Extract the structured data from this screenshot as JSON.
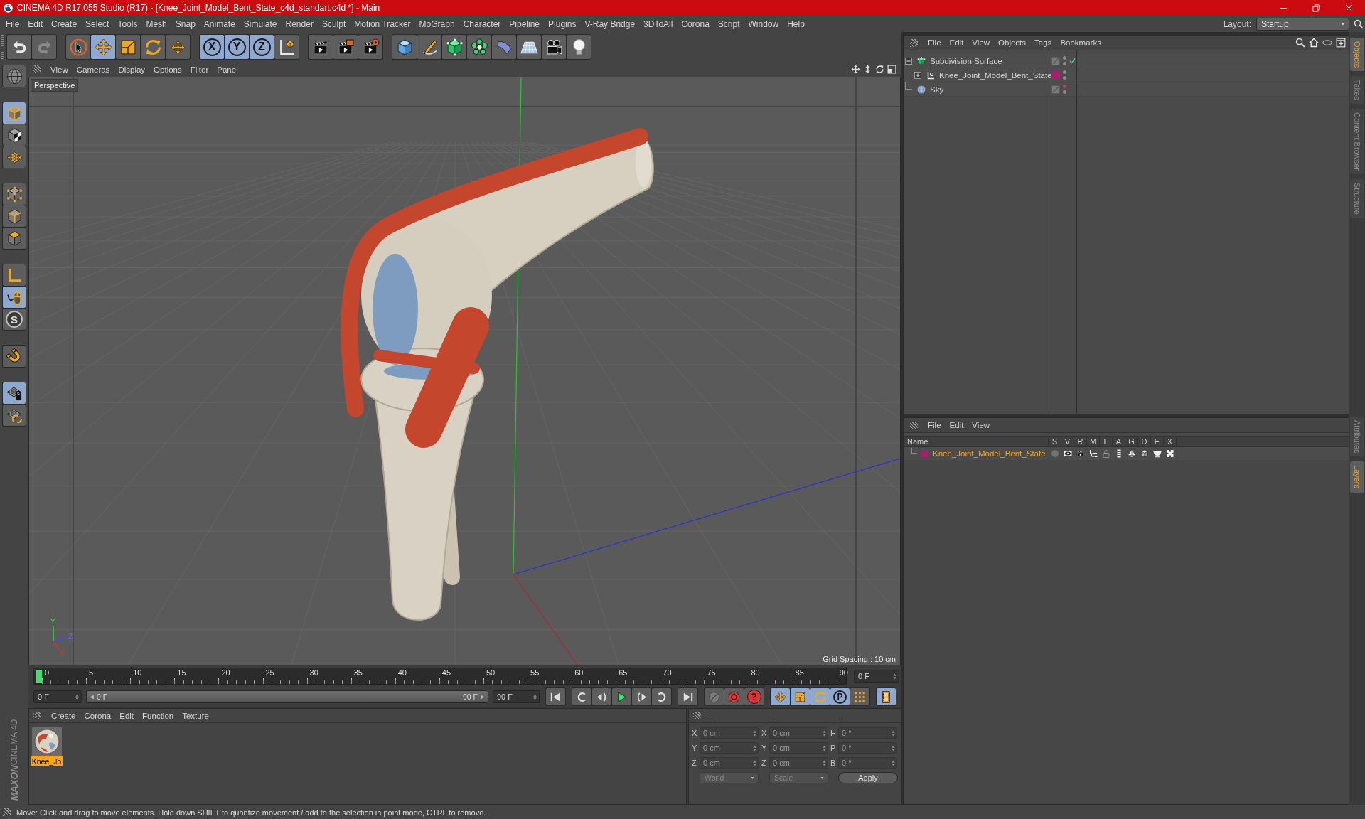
{
  "title_bar": {
    "title": "CINEMA 4D R17.055 Studio (R17) - [Knee_Joint_Model_Bent_State_c4d_standart.c4d *] - Main"
  },
  "menu_bar": {
    "items": [
      "File",
      "Edit",
      "Create",
      "Select",
      "Tools",
      "Mesh",
      "Snap",
      "Animate",
      "Simulate",
      "Render",
      "Sculpt",
      "Motion Tracker",
      "MoGraph",
      "Character",
      "Pipeline",
      "Plugins",
      "V-Ray Bridge",
      "3DToAll",
      "Corona",
      "Script",
      "Window",
      "Help"
    ],
    "layout_label": "Layout:",
    "layout_value": "Startup"
  },
  "toolbar": {
    "groups": [
      [
        {
          "kind": "undo",
          "active": false,
          "disabled": false
        },
        {
          "kind": "redo",
          "active": false,
          "disabled": true
        }
      ],
      [
        {
          "kind": "select",
          "active": false
        },
        {
          "kind": "move",
          "active": true
        },
        {
          "kind": "scale",
          "active": false
        },
        {
          "kind": "rotate",
          "active": false
        },
        {
          "kind": "transform",
          "active": false
        }
      ],
      [
        {
          "kind": "axis-lock",
          "label": "X",
          "active": true
        },
        {
          "kind": "axis-lock",
          "label": "Y",
          "active": true
        },
        {
          "kind": "axis-lock",
          "label": "Z",
          "active": true
        },
        {
          "kind": "coordinates",
          "active": false
        }
      ],
      [
        {
          "kind": "render-view",
          "active": false
        },
        {
          "kind": "render-picture",
          "active": false
        },
        {
          "kind": "render-settings",
          "active": false
        }
      ],
      [
        {
          "kind": "cube",
          "active": false
        },
        {
          "kind": "pen",
          "active": false
        },
        {
          "kind": "subdivision",
          "active": false
        },
        {
          "kind": "cloner",
          "active": false
        },
        {
          "kind": "bend",
          "active": false
        },
        {
          "kind": "floor",
          "active": false
        },
        {
          "kind": "camera",
          "active": false
        },
        {
          "kind": "light",
          "active": false
        }
      ]
    ]
  },
  "left_toolbar": {
    "groups": [
      [
        {
          "kind": "globe",
          "active": false
        }
      ],
      [
        {
          "kind": "model",
          "active": true
        },
        {
          "kind": "texture",
          "active": false
        },
        {
          "kind": "workplane",
          "active": false
        }
      ],
      [
        {
          "kind": "points-mode",
          "active": false
        },
        {
          "kind": "edges-mode",
          "active": false
        },
        {
          "kind": "polygons-mode",
          "active": false
        }
      ],
      [
        {
          "kind": "axis-mode",
          "active": false
        },
        {
          "kind": "tweak",
          "active": true
        },
        {
          "kind": "snap",
          "label": "S",
          "active": false
        }
      ],
      [
        {
          "kind": "magnet",
          "active": false
        }
      ],
      [
        {
          "kind": "workplane-lock",
          "active": true
        },
        {
          "kind": "grid-rotate",
          "active": false
        }
      ]
    ]
  },
  "logo": {
    "brand": "MAXON",
    "product": "CINEMA 4D"
  },
  "viewport": {
    "menu": [
      "View",
      "Cameras",
      "Display",
      "Options",
      "Filter",
      "Panel"
    ],
    "camera": "Perspective",
    "grid_spacing": "Grid Spacing : 10 cm",
    "axis_labels": {
      "y": "Y",
      "z": "Z",
      "x": "X"
    }
  },
  "timeline": {
    "ticks": [
      "0",
      "5",
      "10",
      "15",
      "20",
      "25",
      "30",
      "35",
      "40",
      "45",
      "50",
      "55",
      "60",
      "65",
      "70",
      "75",
      "80",
      "85",
      "90"
    ],
    "level": 0,
    "current_frame": "0 F"
  },
  "playback": {
    "start": "0 F",
    "range": {
      "start_label": "0 F",
      "end_label": "90 F",
      "level": 1
    },
    "end": "90 F",
    "transport": [
      {
        "kind": "go-start"
      },
      {
        "kind": "prev-key"
      },
      {
        "kind": "prev-frame"
      },
      {
        "kind": "play"
      },
      {
        "kind": "next-frame"
      },
      {
        "kind": "next-key"
      },
      {
        "kind": "go-end"
      }
    ],
    "key_buttons": [
      {
        "kind": "record"
      },
      {
        "kind": "autokey"
      },
      {
        "kind": "key-selection",
        "label": "?"
      }
    ],
    "modes": [
      {
        "kind": "move",
        "active": true
      },
      {
        "kind": "scale",
        "active": true
      },
      {
        "kind": "rotate",
        "active": true
      },
      {
        "kind": "param",
        "label": "P",
        "active": true
      },
      {
        "kind": "point-level",
        "active": false
      }
    ],
    "timeline_button": {
      "active": true
    }
  },
  "material_manager": {
    "menu": [
      "Create",
      "Corona",
      "Edit",
      "Function",
      "Texture"
    ],
    "materials": [
      {
        "name": "Knee_Jo",
        "selected": true
      }
    ]
  },
  "coordinates": {
    "columns": [
      {
        "header": "--",
        "fields": [
          {
            "label": "X",
            "value": "0 cm"
          },
          {
            "label": "Y",
            "value": "0 cm"
          },
          {
            "label": "Z",
            "value": "0 cm"
          }
        ]
      },
      {
        "header": "--",
        "fields": [
          {
            "label": "X",
            "value": "0 cm"
          },
          {
            "label": "Y",
            "value": "0 cm"
          },
          {
            "label": "Z",
            "value": "0 cm"
          }
        ]
      },
      {
        "header": "--",
        "fields": [
          {
            "label": "H",
            "value": "0 °"
          },
          {
            "label": "P",
            "value": "0 °"
          },
          {
            "label": "B",
            "value": "0 °"
          }
        ]
      }
    ],
    "dropdowns": [
      "World",
      "Scale"
    ],
    "apply": "Apply"
  },
  "object_manager": {
    "menu": [
      "File",
      "Edit",
      "View",
      "Objects",
      "Tags",
      "Bookmarks"
    ],
    "objects": [
      {
        "name": "Subdivision Surface",
        "kind": "subdivision",
        "expanded": true,
        "selected": false,
        "hidden_in_editor": false,
        "hidden_in_render": false,
        "enabled": true,
        "children": [
          {
            "name": "Knee_Joint_Model_Bent_State",
            "kind": "null",
            "expanded": false,
            "selected": false,
            "color": "#a3206e",
            "hidden_in_editor": false,
            "hidden_in_render": false
          }
        ]
      },
      {
        "name": "Sky",
        "kind": "sky",
        "selected": false,
        "hidden_in_editor": true,
        "hidden_in_render": false
      }
    ]
  },
  "layer_manager": {
    "menu": [
      "File",
      "Edit",
      "View"
    ],
    "columns": [
      "Name",
      "S",
      "V",
      "R",
      "M",
      "L",
      "A",
      "G",
      "D",
      "E",
      "X"
    ],
    "layers": [
      {
        "name": "Knee_Joint_Model_Bent_State",
        "color": "#a3206e",
        "selected": true,
        "switches": [
          {
            "kind": "solo",
            "on": false
          },
          {
            "kind": "view",
            "on": true
          },
          {
            "kind": "render",
            "on": true
          },
          {
            "kind": "manager",
            "on": true
          },
          {
            "kind": "locked",
            "on": false
          },
          {
            "kind": "animation",
            "on": true
          },
          {
            "kind": "generators",
            "on": true
          },
          {
            "kind": "deformers",
            "on": true
          },
          {
            "kind": "expressions",
            "on": true
          },
          {
            "kind": "xref",
            "on": true
          }
        ]
      }
    ]
  },
  "side_tabs": {
    "upper": [
      {
        "label": "Objects",
        "selected": true
      },
      {
        "label": "Takes",
        "selected": false
      },
      {
        "label": "Content Browser",
        "selected": false
      },
      {
        "label": "Structure",
        "selected": false
      }
    ],
    "lower": [
      {
        "label": "Attributes",
        "selected": false
      },
      {
        "label": "Layers",
        "selected": true
      }
    ]
  },
  "status_bar": {
    "text": "Move: Click and drag to move elements. Hold down SHIFT to quantize movement / add to the selection in point mode, CTRL to remove."
  }
}
